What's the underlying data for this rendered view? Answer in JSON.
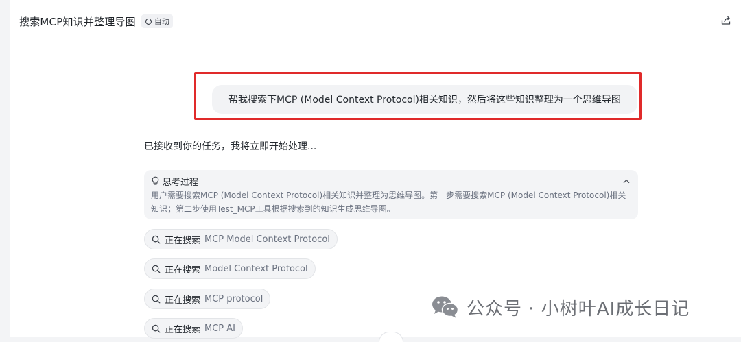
{
  "header": {
    "title": "搜索MCP知识并整理导图",
    "mode_badge": "自动",
    "share_icon": "share-icon"
  },
  "conversation": {
    "user_message": "帮我搜索下MCP (Model Context Protocol)相关知识，然后将这些知识整理为一个思维导图",
    "assistant_ack": "已接收到你的任务，我将立即开始处理...",
    "thinking": {
      "title": "思考过程",
      "content": "用户需要搜索MCP (Model Context Protocol)相关知识并整理为思维导图。第一步需要搜索MCP (Model Context Protocol)相关知识；第二步使用Test_MCP工具根据搜索到的知识生成思维导图。"
    },
    "searches": [
      {
        "label": "正在搜索",
        "query": "MCP Model Context Protocol"
      },
      {
        "label": "正在搜索",
        "query": "Model Context Protocol"
      },
      {
        "label": "正在搜索",
        "query": "MCP protocol"
      },
      {
        "label": "正在搜索",
        "query": "MCP AI"
      }
    ]
  },
  "watermark": {
    "dot": "·",
    "text": "公众号 · 小树叶AI成长日记"
  },
  "colors": {
    "highlight_frame": "#e02a2a",
    "bubble_bg": "#f2f3f5",
    "muted_text": "#6b7280"
  }
}
